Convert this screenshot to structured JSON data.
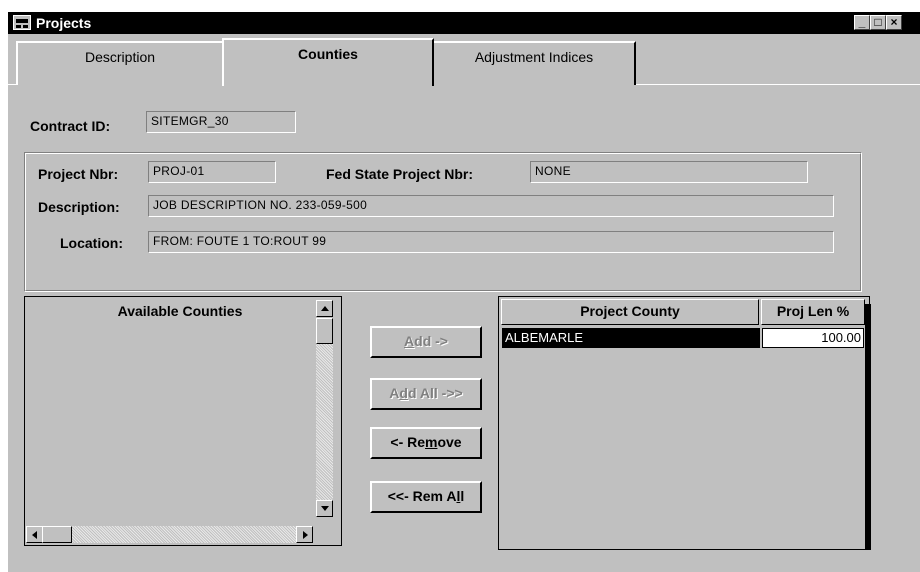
{
  "window": {
    "title": "Projects",
    "controls": {
      "minimize_icon": "minimize-icon",
      "maximize_icon": "maximize-icon",
      "close_icon": "close-icon"
    }
  },
  "tabs": [
    {
      "label": "Description",
      "active": false
    },
    {
      "label": "Counties",
      "active": true
    },
    {
      "label": "Adjustment Indices",
      "active": false
    }
  ],
  "form": {
    "contract_id_label": "Contract ID:",
    "contract_id_value": "SITEMGR_30",
    "project_nbr_label": "Project Nbr:",
    "project_nbr_value": "PROJ-01",
    "fed_state_label": "Fed State Project Nbr:",
    "fed_state_value": "NONE",
    "description_label": "Description:",
    "description_value": "JOB DESCRIPTION NO. 233-059-500",
    "location_label": "Location:",
    "location_value": "FROM:  FOUTE 1 TO:ROUT 99"
  },
  "available": {
    "header": "Available Counties",
    "items": []
  },
  "buttons": {
    "add": {
      "pre": "",
      "mnemonic": "A",
      "post": "dd ->",
      "enabled": false
    },
    "add_all": {
      "pre": "A",
      "mnemonic": "d",
      "post": "d All ->>",
      "enabled": false
    },
    "remove": {
      "pre": "<- Re",
      "mnemonic": "m",
      "post": "ove",
      "enabled": true
    },
    "rem_all": {
      "pre": "<<- Rem A",
      "mnemonic": "l",
      "post": "l",
      "enabled": true
    }
  },
  "grid": {
    "col_county": "Project County",
    "col_pct": "Proj Len %",
    "rows": [
      {
        "county": "ALBEMARLE",
        "pct": "100.00"
      }
    ]
  },
  "colors": {
    "face": "#c0c0c0",
    "highlight": "#ffffff",
    "shadow": "#808080",
    "selection": "#000000"
  }
}
